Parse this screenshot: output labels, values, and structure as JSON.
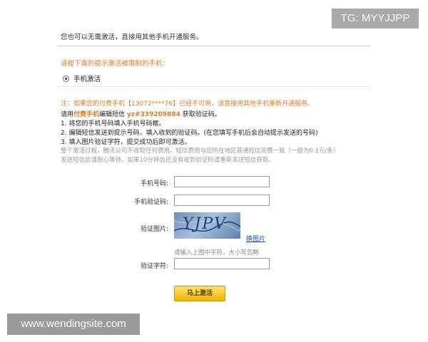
{
  "watermark_top": "TG: MYYJJPP",
  "intro": "您也可以无需激活，直接用其他手机开通服务。",
  "choose_phone": "请按下面的提示激活被限制的手机：",
  "option_label": "手机激活",
  "note": "注：如果您的付费手机【13072****76】已经不可用，请直接用其他手机重新开通服务。",
  "sms": {
    "pre": "请用",
    "highlight_phone": "付费手机",
    "mid": "编辑短信 ",
    "code": "yz#339209884",
    "post": " 获取验证码。"
  },
  "steps": [
    "1. 将您的手机号码填入手机号码框。",
    "2. 编辑短信发送到提示号码，填入收到的验证码。(在您填写手机后会自动提示发送的号码)",
    "3. 填入图片验证字符，提交成功后即可激活。"
  ],
  "info": [
    "整个激活过程，腾讯公司不收取任何费用。短信费用与您所在地区普通短信资费一致（一般为0.1元/条）",
    "发送短信后请耐心等待，如果10分钟后还没有收到验证码请重新发送短信获取。"
  ],
  "form": {
    "phone_label": "手机号码:",
    "sms_code_label": "手机验证码:",
    "captcha_label": "验证图片:",
    "captcha_text": "YJPV",
    "refresh_link": "换图片",
    "captcha_hint": "请输入上图中字符，大小写忽略",
    "chars_label": "验证字符:",
    "phone_value": "",
    "sms_code_value": "",
    "chars_value": ""
  },
  "activate_button": "马上激活",
  "watermark_bottom": "www.wendingsite.com"
}
